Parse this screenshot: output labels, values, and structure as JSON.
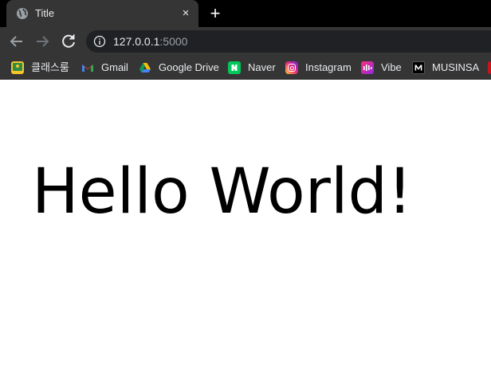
{
  "browser": {
    "tab": {
      "title": "Title",
      "favicon": "globe-icon",
      "close_glyph": "×"
    },
    "new_tab_glyph": "+",
    "address": {
      "host": "127.0.0.1",
      "port": ":5000"
    },
    "bookmarks": [
      {
        "label": "클래스룸",
        "icon": "google-classroom-icon"
      },
      {
        "label": "Gmail",
        "icon": "gmail-icon"
      },
      {
        "label": "Google Drive",
        "icon": "google-drive-icon"
      },
      {
        "label": "Naver",
        "icon": "naver-icon"
      },
      {
        "label": "Instagram",
        "icon": "instagram-icon"
      },
      {
        "label": "Vibe",
        "icon": "vibe-icon"
      },
      {
        "label": "MUSINSA",
        "icon": "musinsa-icon"
      }
    ],
    "colors": {
      "tabstrip": "#000000",
      "toolbar": "#353535",
      "omnibox": "#202124",
      "text": "#e8eaed"
    }
  },
  "page": {
    "heading": "Hello World!"
  }
}
